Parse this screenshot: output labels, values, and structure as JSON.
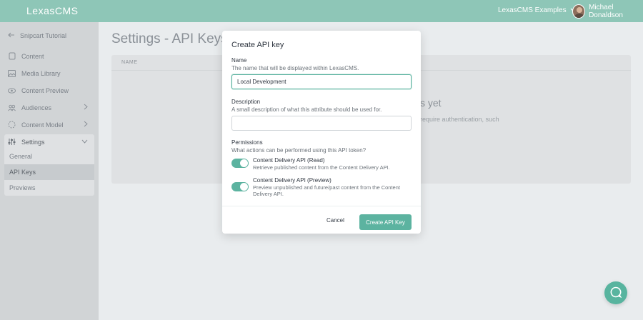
{
  "app": {
    "logo": "LexasCMS"
  },
  "header": {
    "site_switcher": "LexasCMS Examples",
    "user_name": "Michael Donaldson"
  },
  "sidebar": {
    "back_label": "Snipcart Tutorial",
    "items": [
      {
        "label": "Content",
        "icon": "content-icon"
      },
      {
        "label": "Media Library",
        "icon": "image-icon"
      },
      {
        "label": "Content Preview",
        "icon": "eye-icon"
      },
      {
        "label": "Audiences",
        "icon": "users-icon"
      },
      {
        "label": "Content Model",
        "icon": "model-icon"
      },
      {
        "label": "Settings",
        "icon": "sliders-icon"
      }
    ],
    "settings_sub": [
      {
        "label": "General"
      },
      {
        "label": "API Keys"
      },
      {
        "label": "Previews"
      }
    ]
  },
  "main": {
    "title": "Settings - API Keys",
    "column_name": "NAME",
    "empty_title": "s yet",
    "empty_text": "require authentication, such"
  },
  "modal": {
    "title": "Create API key",
    "name_label": "Name",
    "name_help": "The name that will be displayed within LexasCMS.",
    "name_value": "Local Development",
    "description_label": "Description",
    "description_help": "A small description of what this attribute should be used for.",
    "description_value": "",
    "permissions_label": "Permissions",
    "permissions_help": "What actions can be performed using this API token?",
    "permissions": [
      {
        "title": "Content Delivery API (Read)",
        "desc": "Retrieve published content from the Content Delivery API.",
        "enabled": true
      },
      {
        "title": "Content Delivery API (Preview)",
        "desc": "Preview unpublished and future/past content from the Content Delivery API.",
        "enabled": true
      }
    ],
    "cancel_label": "Cancel",
    "create_label": "Create API Key"
  },
  "colors": {
    "accent": "#5cb3a0",
    "topbar": "#8ec6b7"
  }
}
